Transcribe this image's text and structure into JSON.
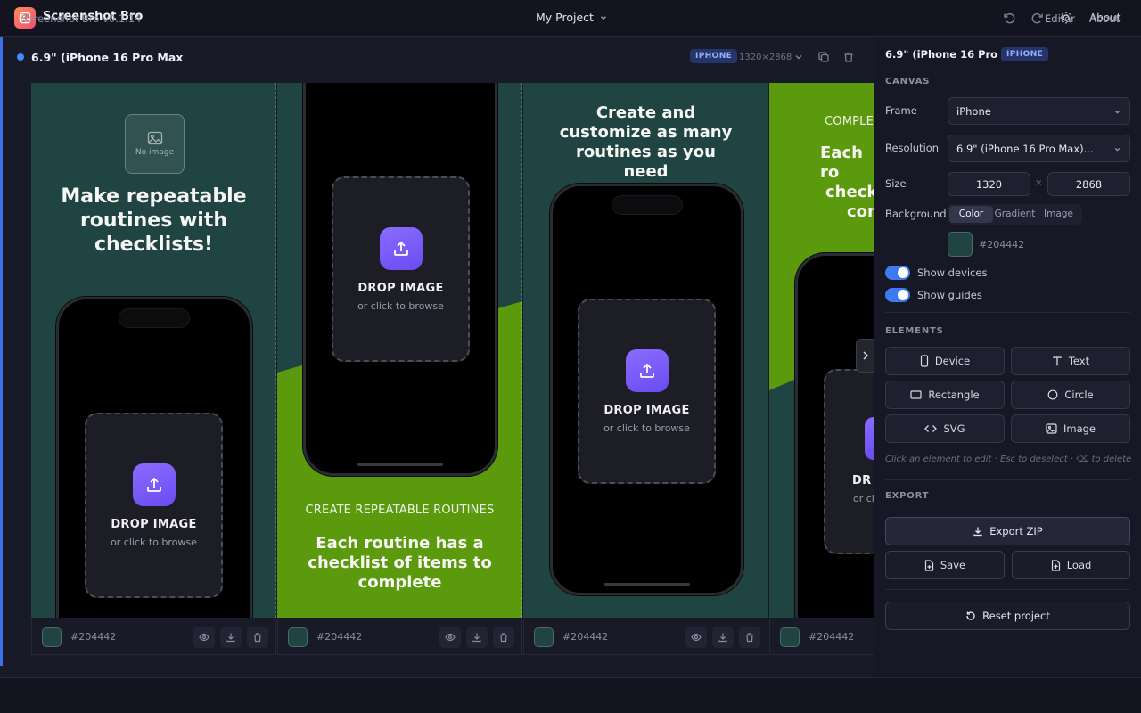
{
  "app": {
    "name": "Screenshot Bro",
    "project": "My Project",
    "about": "About"
  },
  "device": {
    "title": "6.9\" (iPhone 16 Pro Max",
    "badge": "IPHONE",
    "dims": "1320×2868"
  },
  "slides": [
    {
      "bg": "#204442",
      "no_image": "No image",
      "headline": "Make repeatable routines with checklists!",
      "drop": "DROP IMAGE",
      "browse": "or click to browse",
      "hex": "#204442"
    },
    {
      "bg": "#204442",
      "accent": "#5b9a0d",
      "subtitle": "CREATE REPEATABLE ROUTINES",
      "headline": "Each routine has a checklist of items to complete",
      "drop": "DROP IMAGE",
      "browse": "or click to browse",
      "hex": "#204442"
    },
    {
      "bg": "#204442",
      "headline": "Create and customize as many routines as you need",
      "drop": "DROP IMAGE",
      "browse": "or click to browse",
      "hex": "#204442"
    },
    {
      "bg": "#204442",
      "accent": "#5b9a0d",
      "subtitle": "COMPLE",
      "headline_lines": [
        "Each ro",
        "check",
        "com"
      ],
      "drop": "DR",
      "browse": "or cli",
      "hex": "#204442"
    }
  ],
  "sidebar": {
    "title": "6.9\" (iPhone 16 Pro Max",
    "badge": "IPHONE",
    "canvas_section": "CANVAS",
    "frame_label": "Frame",
    "frame_value": "iPhone",
    "resolution_label": "Resolution",
    "resolution_value": "6.9\" (iPhone 16 Pro Max)...",
    "size_label": "Size",
    "width": "1320",
    "times": "×",
    "height": "2868",
    "background_label": "Background",
    "bg_modes": [
      "Color",
      "Gradient",
      "Image"
    ],
    "bg_hex": "#204442",
    "show_devices": "Show devices",
    "show_guides": "Show guides",
    "elements_section": "ELEMENTS",
    "elements": [
      "Device",
      "Text",
      "Rectangle",
      "Circle",
      "SVG",
      "Image"
    ],
    "hint": "Click an element to edit · Esc to deselect · ⌫ to delete",
    "export_section": "EXPORT",
    "export_zip": "Export ZIP",
    "save": "Save",
    "load": "Load",
    "reset": "Reset project"
  },
  "footer": {
    "version": "Screenshot Bro v0.1.14",
    "editor": "Editor",
    "about": "About"
  },
  "colors": {
    "accent_blue": "#3f7bf0",
    "slide_bg": "#204442",
    "green": "#5b9a0d",
    "upload": "#7a5cf7"
  }
}
